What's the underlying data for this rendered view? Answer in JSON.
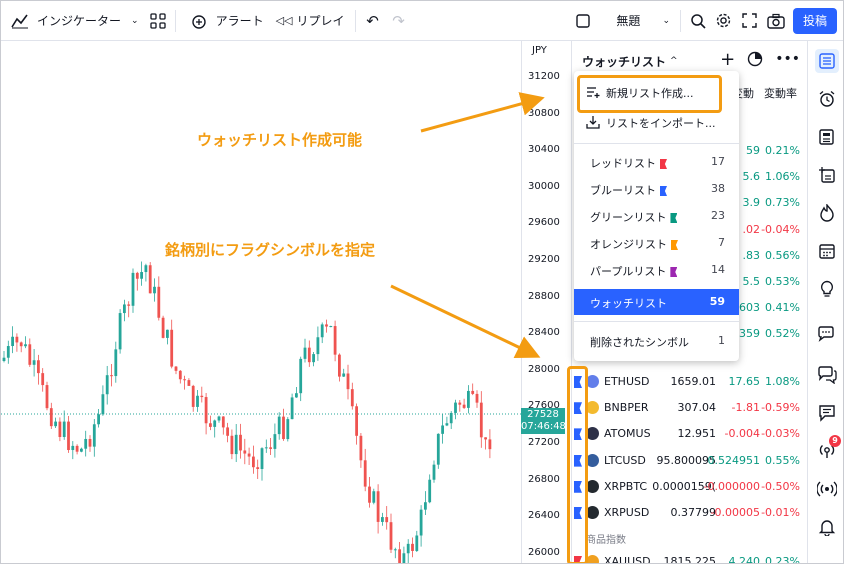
{
  "toolbar": {
    "indicators_label": "インジケーター",
    "alert_label": "アラート",
    "replay_label": "リプレイ",
    "layout_name": "無題",
    "publish_label": "投稿"
  },
  "chart": {
    "currency": "JPY",
    "price_labels": [
      "31200",
      "30800",
      "30400",
      "30000",
      "29600",
      "29200",
      "28800",
      "28400",
      "28000",
      "27600",
      "27200",
      "26800",
      "26400",
      "26000"
    ],
    "last_price": "27528",
    "countdown": "07:46:48"
  },
  "watchlist": {
    "title": "ウォッチリスト",
    "col_change": "変動",
    "col_pct": "変動率",
    "partial_rows": [
      {
        "chg": "59",
        "pct": "0.21%",
        "chg_dir": "pos",
        "pct_dir": "pos"
      },
      {
        "chg": "5.6",
        "pct": "1.06%",
        "chg_dir": "pos",
        "pct_dir": "pos"
      },
      {
        "chg": "3.9",
        "pct": "0.73%",
        "chg_dir": "pos",
        "pct_dir": "pos"
      },
      {
        "chg": ".02",
        "pct": "-0.04%",
        "chg_dir": "neg",
        "pct_dir": "neg"
      },
      {
        "chg": ".83",
        "pct": "0.56%",
        "chg_dir": "pos",
        "pct_dir": "pos"
      },
      {
        "chg": "5.5",
        "pct": "0.53%",
        "chg_dir": "pos",
        "pct_dir": "pos"
      },
      {
        "chg": "603",
        "pct": "0.41%",
        "chg_dir": "pos",
        "pct_dir": "pos"
      },
      {
        "chg": "359",
        "pct": "0.52%",
        "chg_dir": "pos",
        "pct_dir": "pos"
      }
    ],
    "rows": [
      {
        "sym": "ETHUSD",
        "last": "1659.01",
        "chg": "17.65",
        "pct": "1.08%",
        "dir": "pos",
        "icon_color": "#627eea"
      },
      {
        "sym": "BNBPER",
        "last": "307.04",
        "chg": "-1.81",
        "pct": "-0.59%",
        "dir": "neg",
        "icon_color": "#f3ba2f"
      },
      {
        "sym": "ATOMUS",
        "last": "12.951",
        "chg": "-0.004",
        "pct": "-0.03%",
        "dir": "neg",
        "icon_color": "#2e3148"
      },
      {
        "sym": "LTCUSD",
        "last": "95.800095",
        "chg": "0.524951",
        "pct": "0.55%",
        "dir": "pos",
        "icon_color": "#345d9d"
      },
      {
        "sym": "XRPBTC",
        "last": "0.0000159(",
        "chg": "-0.000000",
        "pct": "-0.50%",
        "dir": "neg",
        "icon_color": "#23292f"
      },
      {
        "sym": "XRPUSD",
        "last": "0.37799",
        "chg": "-0.00005",
        "pct": "-0.01%",
        "dir": "neg",
        "icon_color": "#23292f"
      },
      {
        "sym": "XAUUSD",
        "last": "1815.225",
        "chg": "4.240",
        "pct": "0.23%",
        "dir": "pos",
        "icon_color": "#f0a020"
      }
    ],
    "section_commodities": "商品指数"
  },
  "menu": {
    "new_list": "新規リスト作成...",
    "import_list": "リストをインポート...",
    "lists": [
      {
        "name": "レッドリスト",
        "count": "17",
        "flag_color": "#f23645"
      },
      {
        "name": "ブルーリスト",
        "count": "38",
        "flag_color": "#2962ff"
      },
      {
        "name": "グリーンリスト",
        "count": "23",
        "flag_color": "#089981"
      },
      {
        "name": "オレンジリスト",
        "count": "7",
        "flag_color": "#ff9800"
      },
      {
        "name": "パープルリスト",
        "count": "14",
        "flag_color": "#9c27b0"
      }
    ],
    "watchlist": {
      "name": "ウォッチリスト",
      "count": "59"
    },
    "deleted": {
      "name": "削除されたシンボル",
      "count": "1"
    }
  },
  "annotations": {
    "create_text": "ウォッチリスト作成可能",
    "flag_text": "銘柄別にフラグシンボルを指定"
  },
  "sidebar": {
    "alert_badge": "9"
  },
  "colors": {
    "accent": "#2962ff",
    "annotation": "#f39c12",
    "up": "#26a69a",
    "down": "#ef5350"
  }
}
